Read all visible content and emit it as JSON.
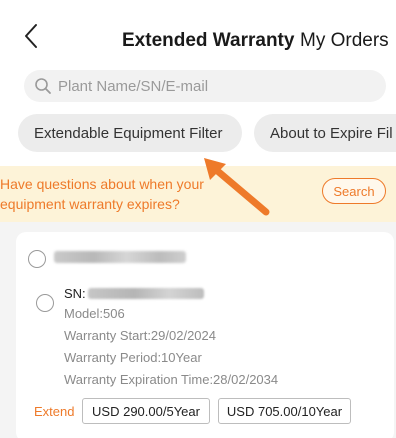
{
  "header": {
    "title": "Extended Warranty",
    "orders_label": "My Orders"
  },
  "search": {
    "placeholder": "Plant Name/SN/E-mail"
  },
  "filters": [
    {
      "label": "Extendable Equipment Filter"
    },
    {
      "label": "About to Expire Fil"
    }
  ],
  "banner": {
    "text": "Have questions about when your equipment warranty expires?",
    "button_label": "Search"
  },
  "device": {
    "sn_label": "SN:",
    "model": "Model:506",
    "warranty_start": "Warranty Start:29/02/2024",
    "warranty_period": "Warranty Period:10Year",
    "warranty_expiration": "Warranty Expiration Time:28/02/2034"
  },
  "extend": {
    "label": "Extend",
    "options": [
      {
        "label": "USD 290.00/5Year"
      },
      {
        "label": "USD 705.00/10Year"
      }
    ]
  },
  "colors": {
    "accent": "#ee7a2a",
    "banner_bg": "#fdf3d8"
  },
  "icons": [
    "back-chevron-icon",
    "search-icon",
    "annotation-arrow"
  ]
}
